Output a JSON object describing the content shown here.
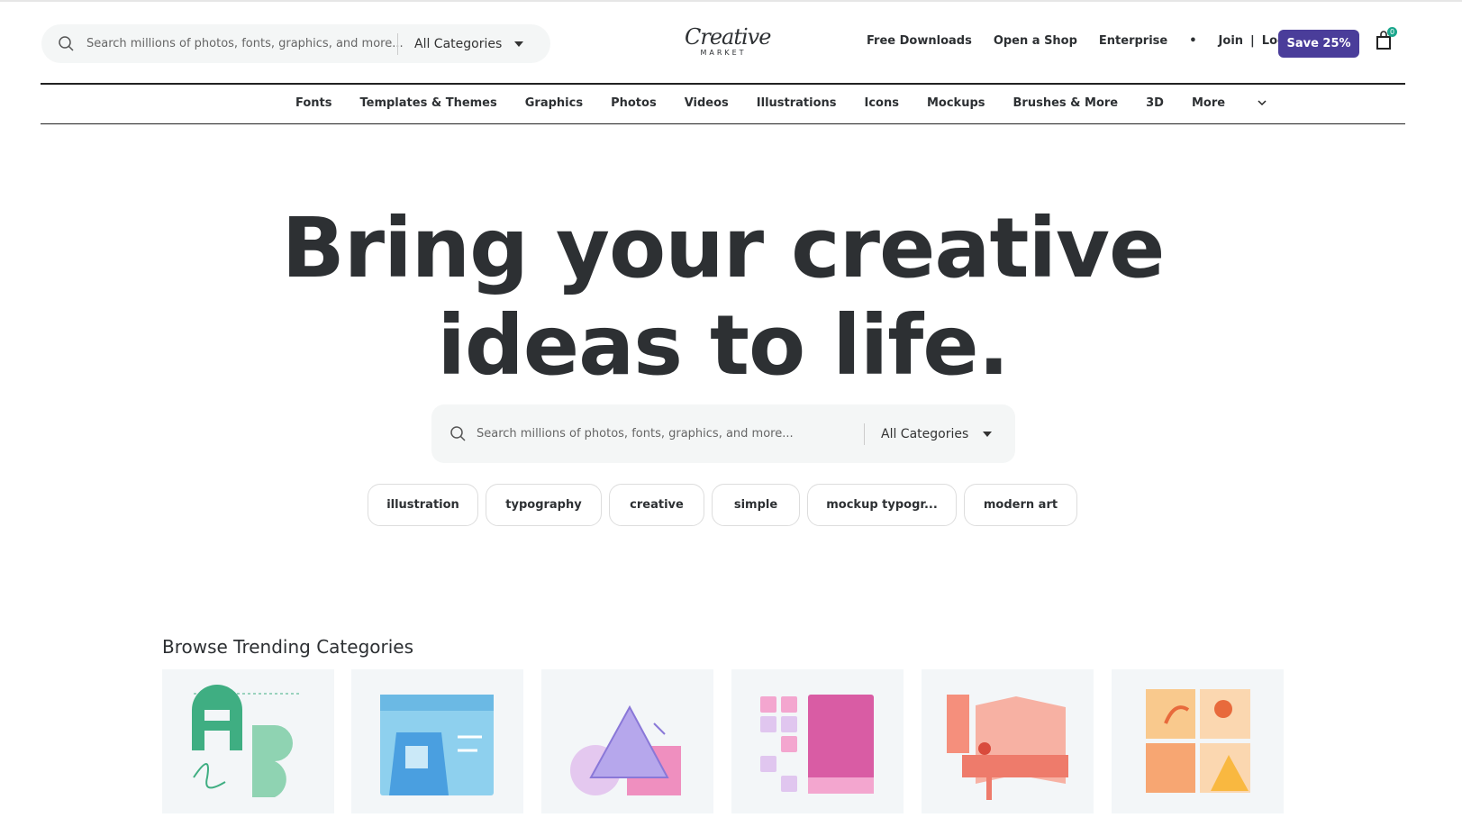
{
  "header": {
    "search_placeholder": "Search millions of photos, fonts, graphics, and more...",
    "category_select": "All Categories",
    "logo_script": "Creative",
    "logo_sub": "MARKET",
    "links": [
      "Free Downloads",
      "Open a Shop",
      "Enterprise",
      "•",
      "Join",
      "|",
      "Log in"
    ],
    "save_button": "Save 25%",
    "cart_count": "0",
    "accent_color": "#4a3d9a"
  },
  "nav": [
    "Fonts",
    "Templates & Themes",
    "Graphics",
    "Photos",
    "Videos",
    "Illustrations",
    "Icons",
    "Mockups",
    "Brushes & More",
    "3D",
    "More"
  ],
  "hero": {
    "title_line1": "Bring your creative",
    "title_line2": "ideas to life.",
    "search_placeholder": "Search millions of photos, fonts, graphics, and more...",
    "category_select": "All Categories",
    "chips": [
      "illustration",
      "typography",
      "creative",
      "simple",
      "mockup typogr...",
      "modern art"
    ]
  },
  "trending": {
    "title": "Browse Trending Categories",
    "cards": [
      "fonts-illustration",
      "templates-illustration",
      "graphics-illustration",
      "themes-illustration",
      "print-illustration",
      "photos-illustration"
    ]
  }
}
